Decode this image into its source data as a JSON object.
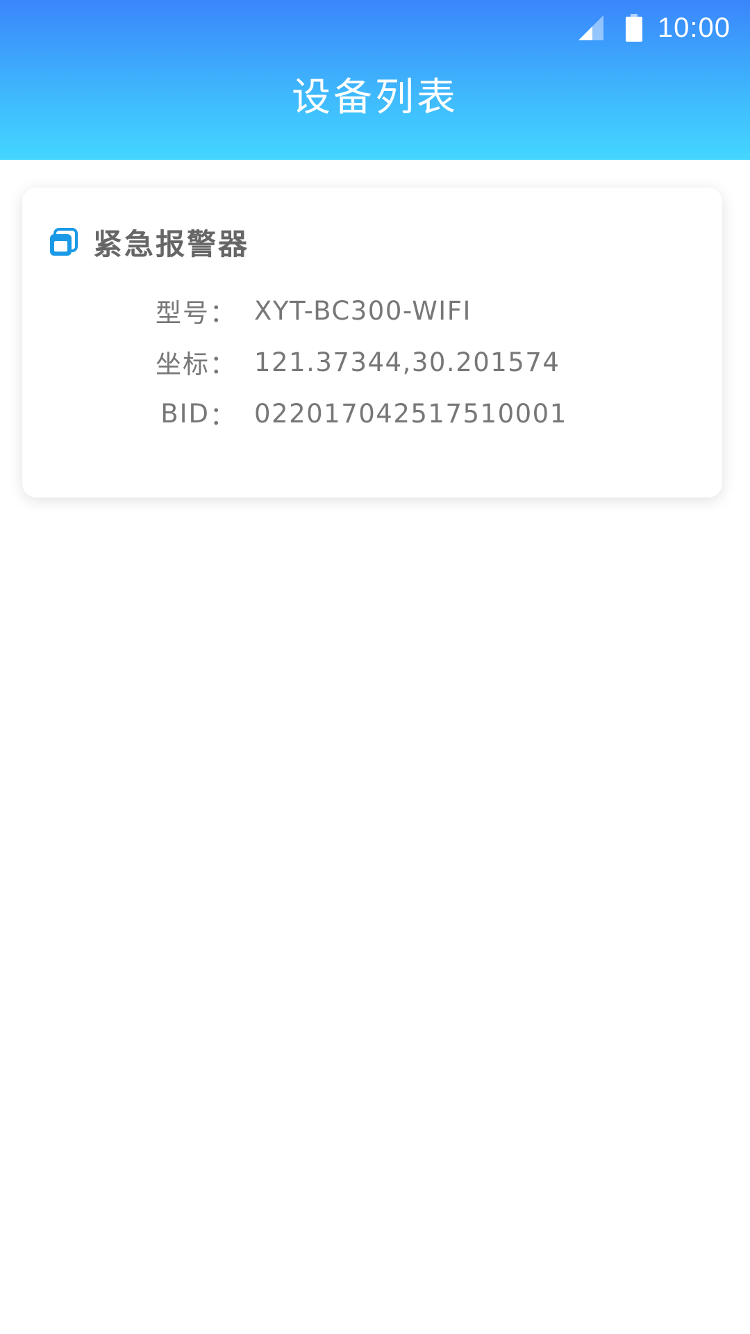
{
  "status_bar": {
    "time": "10:00",
    "signal_icon": "signal-icon",
    "battery_icon": "battery-icon"
  },
  "header": {
    "title": "设备列表",
    "gradient_top": "#3a86fb",
    "gradient_bottom": "#43d6ff"
  },
  "device_card": {
    "icon": "device-window-icon",
    "icon_color": "#1a9ae6",
    "name": "紧急报警器",
    "rows": [
      {
        "label": "型号",
        "colon": "：",
        "value": "XYT-BC300-WIFI"
      },
      {
        "label": "坐标",
        "colon": "：",
        "value": "121.37344,30.201574"
      },
      {
        "label": "BID",
        "colon": "：",
        "value": "022017042517510001"
      }
    ]
  }
}
